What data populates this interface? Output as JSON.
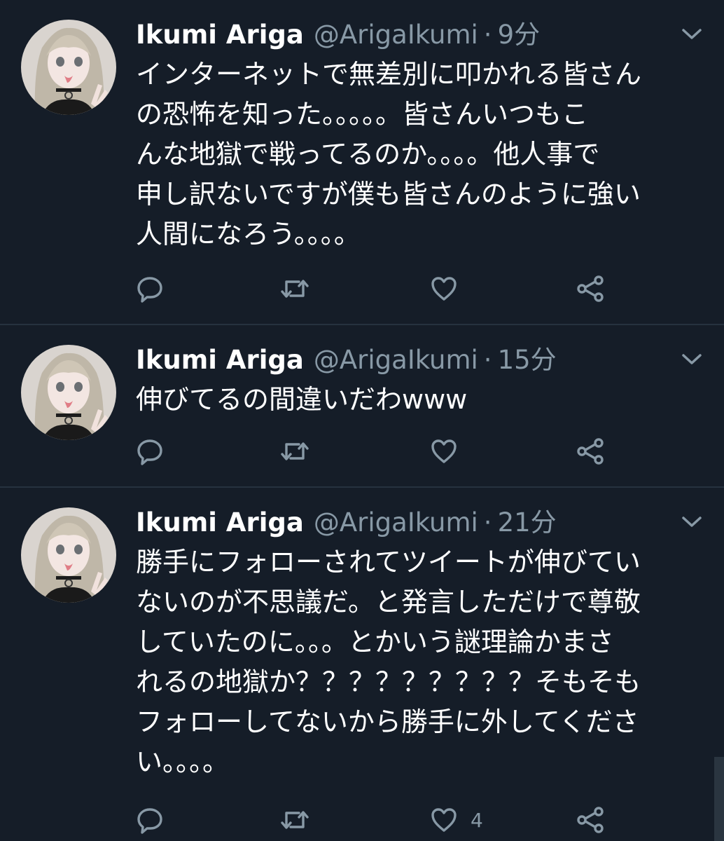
{
  "tweets": [
    {
      "name": "Ikumi Ariga",
      "handle": "@ArigaIkumi",
      "separator": "·",
      "time": "9分",
      "text": "インターネットで無差別に叩かれる皆さん\nの恐怖を知った。。。。。皆さんいつもこ\nんな地獄で戦ってるのか。。。。他人事で\n申し訳ないですが僕も皆さんのように強い\n人間になろう。。。。",
      "like_count": ""
    },
    {
      "name": "Ikumi Ariga",
      "handle": "@ArigaIkumi",
      "separator": "·",
      "time": "15分",
      "text": "伸びてるの間違いだわwww",
      "like_count": ""
    },
    {
      "name": "Ikumi Ariga",
      "handle": "@ArigaIkumi",
      "separator": "·",
      "time": "21分",
      "text": "勝手にフォローされてツイートが伸びてい\nないのが不思議だ。と発言しただけで尊敬\nしていたのに。。。とかいう謎理論かまさ\nれるの地獄か？？？？？？？？？そもそも\nフォローしてないから勝手に外してくださ\nい。。。。",
      "like_count": "4"
    }
  ],
  "icons": {
    "reply": "reply-icon",
    "retweet": "retweet-icon",
    "like": "heart-icon",
    "share": "share-icon",
    "more": "chevron-down-icon"
  },
  "colors": {
    "background": "#151d28",
    "divider": "#26323f",
    "muted": "#8899a6",
    "text": "#ffffff"
  }
}
